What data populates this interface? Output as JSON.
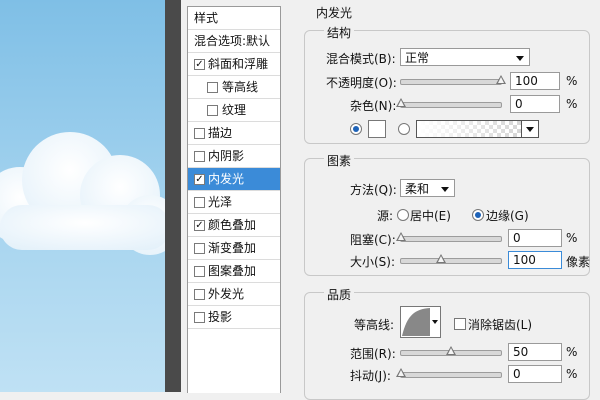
{
  "styles_list": {
    "header": "样式",
    "blend_options": "混合选项:默认",
    "items": [
      {
        "label": "斜面和浮雕",
        "checked": true,
        "level": 0,
        "selected": false
      },
      {
        "label": "等高线",
        "checked": false,
        "level": 1,
        "selected": false
      },
      {
        "label": "纹理",
        "checked": false,
        "level": 1,
        "selected": false
      },
      {
        "label": "描边",
        "checked": false,
        "level": 0,
        "selected": false
      },
      {
        "label": "内阴影",
        "checked": false,
        "level": 0,
        "selected": false
      },
      {
        "label": "内发光",
        "checked": true,
        "level": 0,
        "selected": true
      },
      {
        "label": "光泽",
        "checked": false,
        "level": 0,
        "selected": false
      },
      {
        "label": "颜色叠加",
        "checked": true,
        "level": 0,
        "selected": false
      },
      {
        "label": "渐变叠加",
        "checked": false,
        "level": 0,
        "selected": false
      },
      {
        "label": "图案叠加",
        "checked": false,
        "level": 0,
        "selected": false
      },
      {
        "label": "外发光",
        "checked": false,
        "level": 0,
        "selected": false
      },
      {
        "label": "投影",
        "checked": false,
        "level": 0,
        "selected": false
      }
    ],
    "check_mark": "✓"
  },
  "panel": {
    "title": "内发光",
    "structure": {
      "title": "结构",
      "blend_mode_label": "混合模式(B):",
      "blend_mode_value": "正常",
      "opacity_label": "不透明度(O):",
      "opacity_value": "100",
      "opacity_unit": "%",
      "opacity_level": 1.0,
      "noise_label": "杂色(N):",
      "noise_value": "0",
      "noise_unit": "%",
      "noise_level": 0.0
    },
    "elements": {
      "title": "图素",
      "method_label": "方法(Q):",
      "method_value": "柔和",
      "source_label": "源:",
      "source_center": "居中(E)",
      "source_edge": "边缘(G)",
      "choke_label": "阻塞(C):",
      "choke_value": "0",
      "choke_unit": "%",
      "choke_level": 0.0,
      "size_label": "大小(S):",
      "size_value": "100",
      "size_unit": "像素",
      "size_level": 0.4
    },
    "quality": {
      "title": "品质",
      "contour_label": "等高线:",
      "antialias_label": "消除锯齿(L)",
      "range_label": "范围(R):",
      "range_value": "50",
      "range_unit": "%",
      "range_level": 0.5,
      "jitter_label": "抖动(J):",
      "jitter_value": "0",
      "jitter_unit": "%",
      "jitter_level": 0.0
    }
  },
  "colors": {
    "selection": "#3b8bd8",
    "sky_top": "#7fbfe6",
    "sky_bottom": "#bfe1f4"
  }
}
